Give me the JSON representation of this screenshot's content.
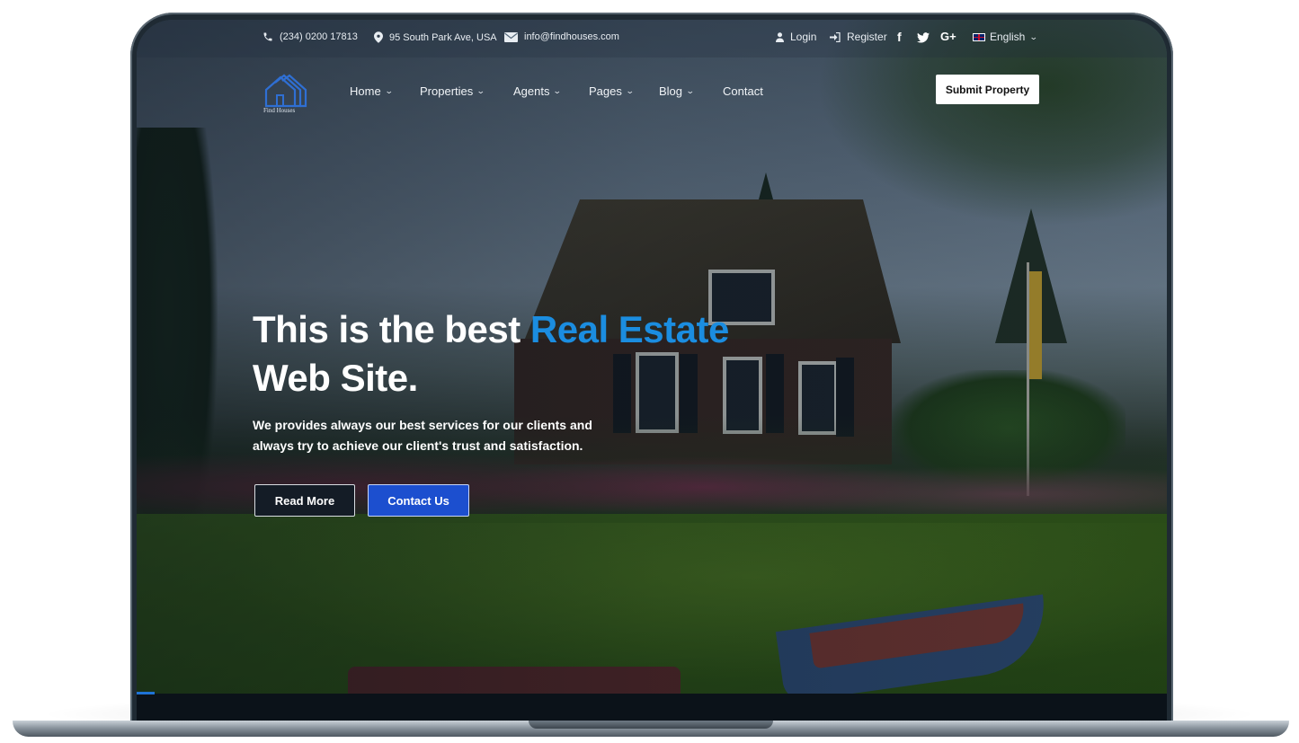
{
  "topbar": {
    "phone": "(234) 0200 17813",
    "address": "95 South Park Ave, USA",
    "email": "info@findhouses.com",
    "login": "Login",
    "register": "Register",
    "social": {
      "facebook": "f",
      "twitter": "twitter-icon",
      "google_plus": "G+"
    },
    "language": "English"
  },
  "logo": {
    "text": "Find Houses",
    "icon": "houses-logo-icon"
  },
  "nav": {
    "items": [
      {
        "label": "Home",
        "has_dropdown": true
      },
      {
        "label": "Properties",
        "has_dropdown": true
      },
      {
        "label": "Agents",
        "has_dropdown": true
      },
      {
        "label": "Pages",
        "has_dropdown": true
      },
      {
        "label": "Blog",
        "has_dropdown": true
      },
      {
        "label": "Contact",
        "has_dropdown": false
      }
    ],
    "submit_label": "Submit Property"
  },
  "hero": {
    "title_pre": "This is the best ",
    "title_accent": "Real Estate",
    "title_post": "Web Site.",
    "subtitle": "We provides always our best services for our clients and always try to achieve our client's trust and satisfaction.",
    "read_more_label": "Read More",
    "contact_label": "Contact Us"
  },
  "colors": {
    "accent": "#1b8de0",
    "contact_button": "#1c4fcf",
    "read_more_button": "#141c26"
  }
}
